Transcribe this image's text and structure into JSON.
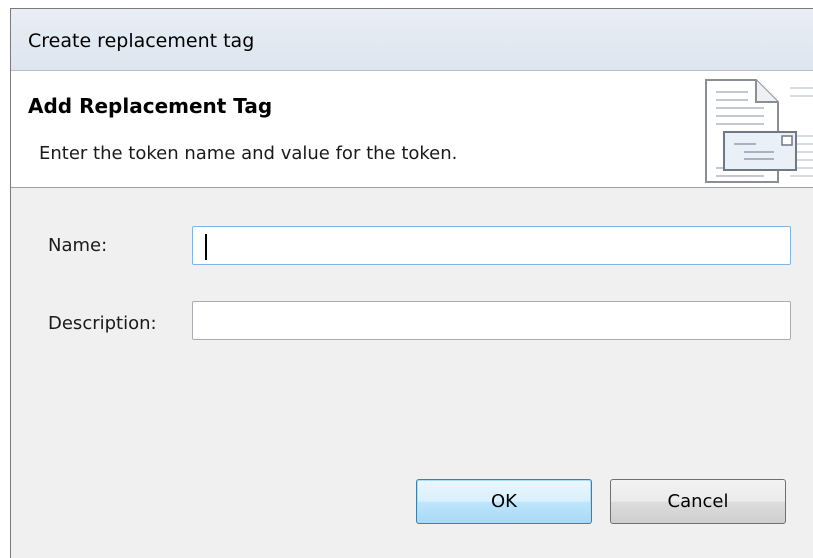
{
  "window": {
    "title": "Create replacement tag"
  },
  "banner": {
    "title": "Add Replacement Tag",
    "description": "Enter the token name and value for the token."
  },
  "form": {
    "name_label": "Name:",
    "name_value": "",
    "description_label": "Description:",
    "description_value": ""
  },
  "buttons": {
    "ok": "OK",
    "cancel": "Cancel"
  },
  "icons": {
    "banner": "document-with-envelope-icon"
  },
  "colors": {
    "focus_border": "#7eb4ea",
    "default_button_border": "#3c7fb1"
  }
}
